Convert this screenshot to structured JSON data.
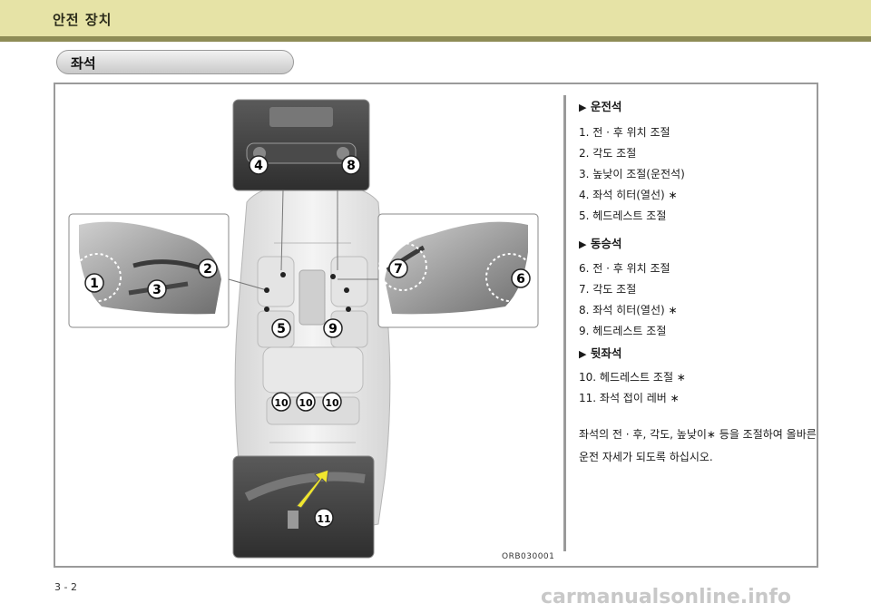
{
  "header": {
    "section_title": "안전 장치"
  },
  "subtitle": {
    "label": "좌석"
  },
  "figure": {
    "code": "ORB030001",
    "callouts": [
      "1",
      "2",
      "3",
      "4",
      "5",
      "6",
      "7",
      "8",
      "9",
      "10",
      "10",
      "10",
      "11"
    ]
  },
  "panel": {
    "driver": {
      "heading": "운전석",
      "items": [
        "1.  전 · 후 위치 조절",
        "2.  각도 조절",
        "3.  높낮이 조절(운전석)",
        "4.  좌석 히터(열선) ∗",
        "5.  헤드레스트 조절"
      ]
    },
    "passenger": {
      "heading": "동승석",
      "items": [
        "6.  전 · 후 위치 조절",
        "7.  각도 조절",
        "8.  좌석 히터(열선) ∗",
        "9.  헤드레스트 조절"
      ]
    },
    "rear": {
      "heading": "뒷좌석",
      "items": [
        "10. 헤드레스트 조절 ∗",
        "11. 좌석 접이 레버 ∗"
      ]
    },
    "body": "좌석의 전 · 후, 각도, 높낮이∗ 등을 조절하여 올바른 운전 자세가 되도록 하십시오."
  },
  "footer": {
    "page": "3 - 2",
    "watermark": "carmanualsonline.info"
  }
}
